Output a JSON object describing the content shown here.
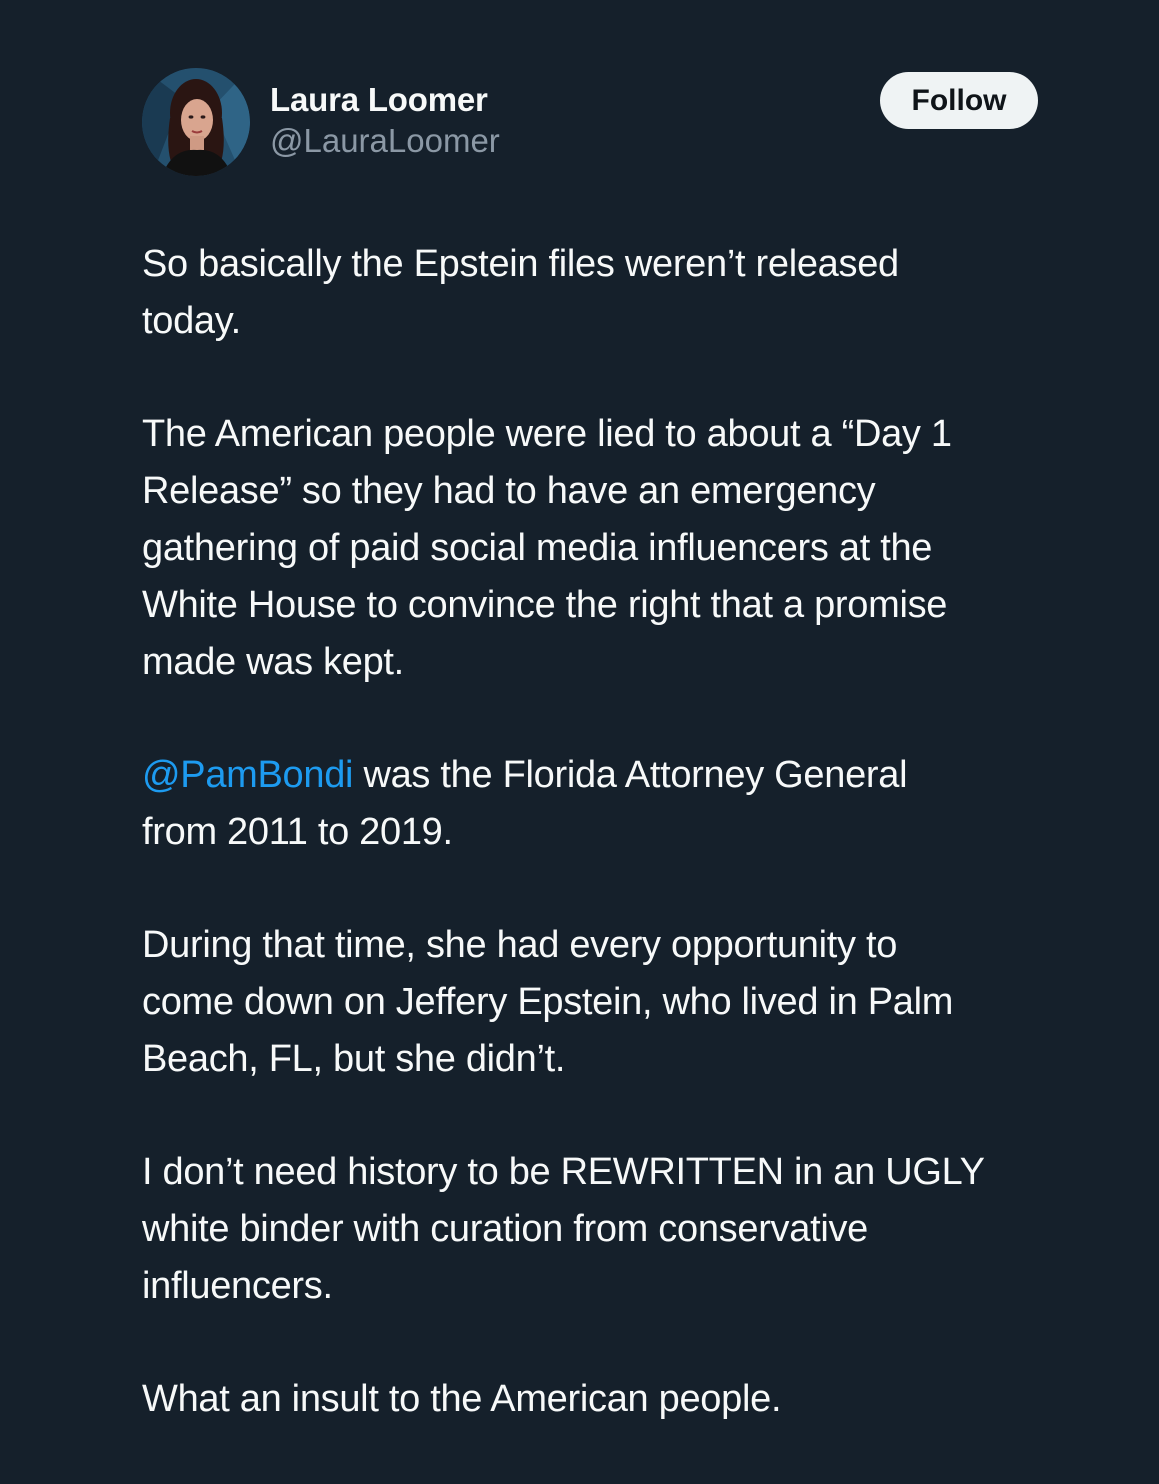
{
  "author": {
    "display_name": "Laura Loomer",
    "handle": "@LauraLoomer",
    "avatar_icon": "profile-photo"
  },
  "follow_button": {
    "label": "Follow"
  },
  "tweet": {
    "paragraphs": [
      {
        "lines": [
          "So basically the Epstein files weren’t released",
          "today."
        ]
      },
      {
        "lines": [
          "The American people were lied to about a “Day 1",
          "Release” so they had to have an emergency",
          "gathering of paid social media influencers at the",
          "White House to convince the right that a promise",
          "made was kept."
        ]
      },
      {
        "mention": "@PamBondi",
        "mention_line_rest": " was the Florida Attorney General",
        "lines_after": [
          "from 2011 to 2019."
        ]
      },
      {
        "lines": [
          "During that time, she had every opportunity to",
          "come down on Jeffery Epstein, who lived in Palm",
          "Beach, FL, but she didn’t."
        ]
      },
      {
        "lines": [
          "I don’t need history to be REWRITTEN in an UGLY",
          "white binder with curation from conservative",
          "influencers."
        ]
      },
      {
        "lines": [
          "What an insult to the American people."
        ]
      }
    ]
  },
  "colors": {
    "background": "#15202b",
    "text": "#f7f9f9",
    "secondary_text": "#8b98a5",
    "link": "#1d9bf0",
    "button_bg": "#eff3f4"
  }
}
